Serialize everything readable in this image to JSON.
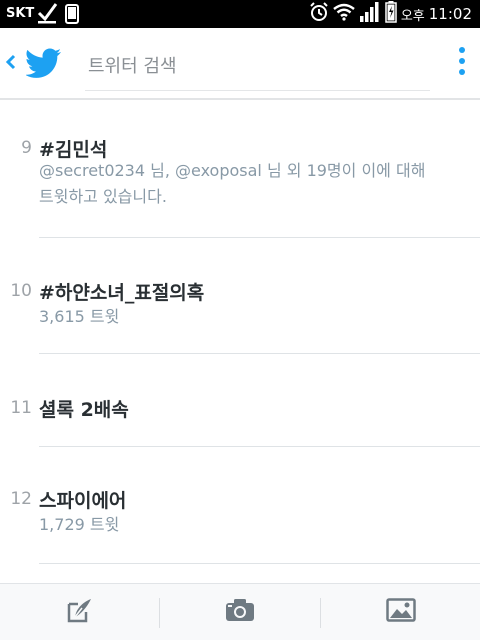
{
  "status_bar": {
    "carrier": "SKT",
    "ampm": "오후",
    "time": "11:02"
  },
  "header": {
    "search_placeholder": "트위터 검색"
  },
  "trends": [
    {
      "rank": "9",
      "name": "#김민석",
      "description": "@secret0234 님, @exoposal 님 외 19명이 이에 대해 트윗하고 있습니다."
    },
    {
      "rank": "10",
      "name": "#하얀소녀_표절의혹",
      "tweet_count": "3,615 트윗"
    },
    {
      "rank": "11",
      "name": "셜록 2배속"
    },
    {
      "rank": "12",
      "name": "스파이에어",
      "tweet_count": "1,729 트윗"
    }
  ],
  "colors": {
    "accent": "#1da1f2",
    "text_primary": "#292f33",
    "text_secondary": "#8899a6",
    "icon_gray": "#6f7a82"
  }
}
